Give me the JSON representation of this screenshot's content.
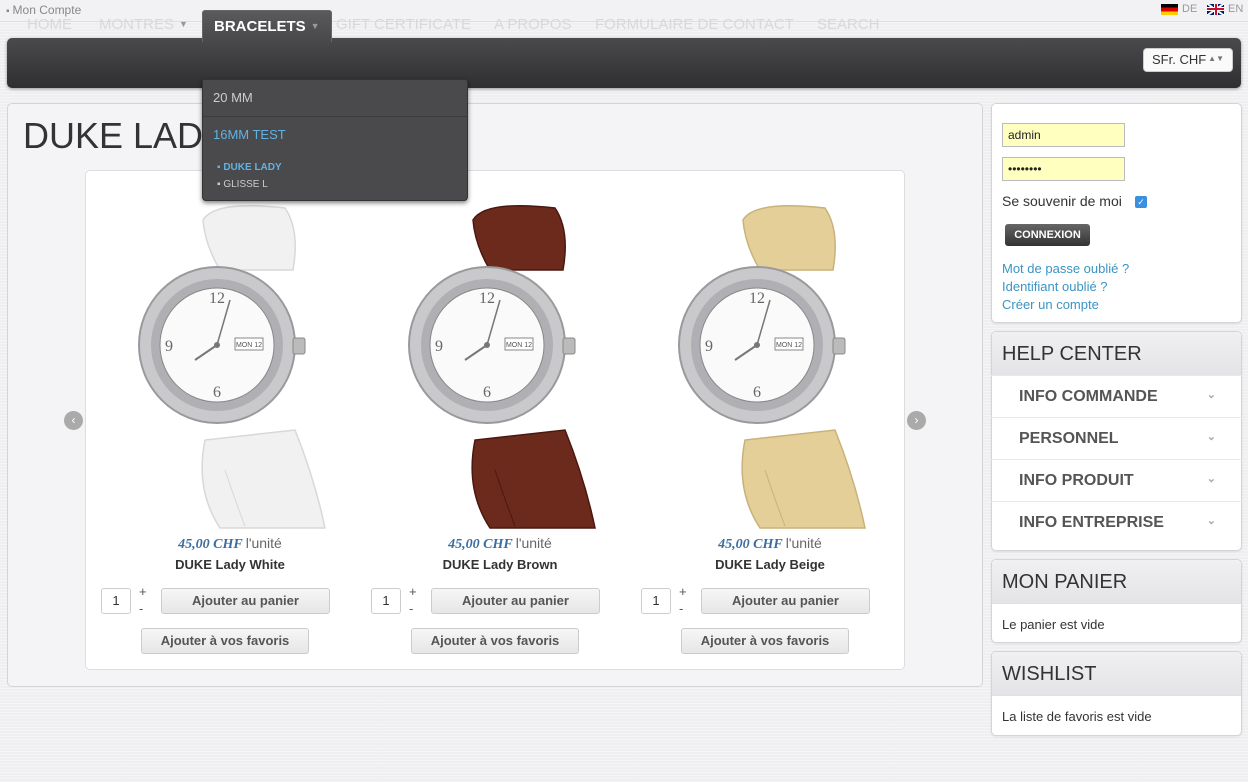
{
  "topbar": {
    "account": "Mon Compte",
    "lang_de": "DE",
    "lang_en": "EN"
  },
  "nav": {
    "items": [
      "HOME",
      "MONTRES",
      "BRACELETS",
      "GIFT CERTIFICATE",
      "A PROPOS",
      "FORMULAIRE DE CONTACT",
      "SEARCH"
    ],
    "active": "BRACELETS",
    "currency": "SFr. CHF"
  },
  "dropdown": {
    "items": [
      "20 MM",
      "16MM TEST"
    ],
    "subitems": [
      "DUKE LADY",
      "GLISSE L"
    ]
  },
  "main": {
    "title": "DUKE LADY",
    "products": [
      {
        "price": "45,00 CHF",
        "unit": "l'unité",
        "name": "DUKE Lady White",
        "qty": "1",
        "strap_color": "#f1f1f1",
        "strap_shadow": "#d8d8d8"
      },
      {
        "price": "45,00 CHF",
        "unit": "l'unité",
        "name": "DUKE Lady Brown",
        "qty": "1",
        "strap_color": "#6b2a1c",
        "strap_shadow": "#4a1810"
      },
      {
        "price": "45,00 CHF",
        "unit": "l'unité",
        "name": "DUKE Lady Beige",
        "qty": "1",
        "strap_color": "#e4cf98",
        "strap_shadow": "#c9b27a"
      }
    ],
    "add_to_cart": "Ajouter au panier",
    "add_to_fav": "Ajouter à vos favoris",
    "plus": "+",
    "minus": "-"
  },
  "login": {
    "username": "admin",
    "password": "••••••••",
    "remember": "Se souvenir de moi",
    "button": "CONNEXION",
    "forgot_password": "Mot de passe oublié ?",
    "forgot_username": "Identifiant oublié ?",
    "create_account": "Créer un compte"
  },
  "help": {
    "title": "HELP CENTER",
    "items": [
      "INFO COMMANDE",
      "PERSONNEL",
      "INFO PRODUIT",
      "INFO ENTREPRISE"
    ]
  },
  "cart": {
    "title": "MON PANIER",
    "text": "Le panier est vide"
  },
  "wishlist": {
    "title": "WISHLIST",
    "text": "La liste de favoris est vide"
  }
}
